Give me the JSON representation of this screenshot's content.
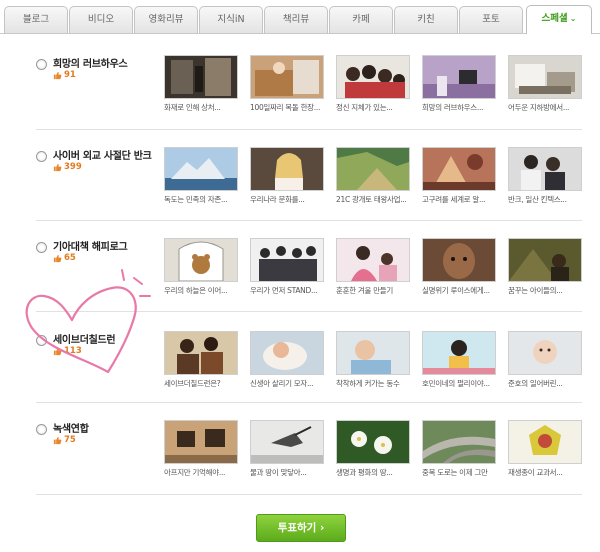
{
  "tabs": [
    "블로그",
    "비디오",
    "영화리뷰",
    "지식iN",
    "책리뷰",
    "카페",
    "키친",
    "포토",
    "스페셜"
  ],
  "active_tab_chevron": "⌄",
  "candidates": [
    {
      "name": "희망의 러브하우스",
      "likes": "91",
      "photos": [
        {
          "caption": "화재로 인해 상처..."
        },
        {
          "caption": "100일짜리 복돌 한장..."
        },
        {
          "caption": "정신 지체가 있는..."
        },
        {
          "caption": "희망의 러브하우스..."
        },
        {
          "caption": "어두운 지하방에서..."
        }
      ]
    },
    {
      "name": "사이버 외교 사절단 반크",
      "likes": "399",
      "photos": [
        {
          "caption": "독도는 민족의 자존..."
        },
        {
          "caption": "우리나라 문화를..."
        },
        {
          "caption": "21C 광개토 태왕사업..."
        },
        {
          "caption": "고구려를 세계로 알..."
        },
        {
          "caption": "반크, 일산 킨텍스..."
        }
      ]
    },
    {
      "name": "기아대책 해피로그",
      "likes": "65",
      "photos": [
        {
          "caption": "우리의 하늘은 이어..."
        },
        {
          "caption": "우리가 먼저 STAND..."
        },
        {
          "caption": "훈훈한 겨울 만들기"
        },
        {
          "caption": "실명위기 루이스에게..."
        },
        {
          "caption": "꿈꾸는 아이들의..."
        }
      ]
    },
    {
      "name": "세이브더칠드런",
      "likes": "113",
      "photos": [
        {
          "caption": "세이브더칠드런은?"
        },
        {
          "caption": "신생아 살리기 모자..."
        },
        {
          "caption": "착착하게 커가는 동수"
        },
        {
          "caption": "호민이네의 펄리이야..."
        },
        {
          "caption": "준호의 일어버린..."
        }
      ]
    },
    {
      "name": "녹색연합",
      "likes": "75",
      "photos": [
        {
          "caption": "아프지만 기억해야..."
        },
        {
          "caption": "물과 땅이 맞닿아..."
        },
        {
          "caption": "생명과 평화의 땅..."
        },
        {
          "caption": "중복 도로는 이제 그만"
        },
        {
          "caption": "재생종이 교과서..."
        }
      ]
    }
  ],
  "vote_button": "투표하기 ›",
  "colors": {
    "accent_green": "#5cab1c",
    "like_orange": "#e07b1f",
    "doodle_pink": "#e879a8"
  }
}
